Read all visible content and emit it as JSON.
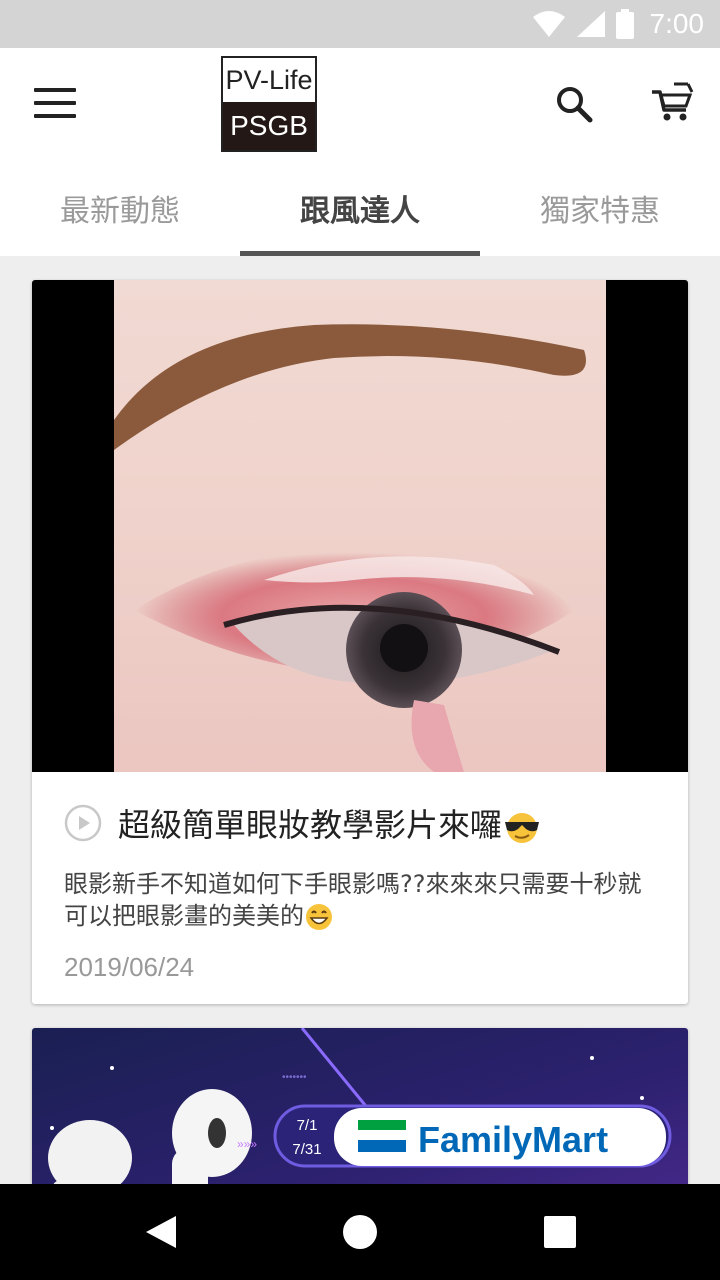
{
  "status_bar": {
    "time": "7:00",
    "icons": [
      "wifi-icon",
      "cellular-icon",
      "battery-icon"
    ]
  },
  "app_bar": {
    "logo_top": "PV-Life",
    "logo_bottom": "PSGB",
    "icons": [
      "menu-icon",
      "search-icon",
      "cart-icon"
    ]
  },
  "tabs": [
    {
      "label": "最新動態",
      "active": false
    },
    {
      "label": "跟風達人",
      "active": true
    },
    {
      "label": "獨家特惠",
      "active": false
    }
  ],
  "feed": {
    "card1": {
      "title": "超級簡單眼妝教學影片來囉",
      "title_emoji": "sunglasses-emoji",
      "description": "眼影新手不知道如何下手眼影嗎??來來來只需要十秒就可以把眼影畫的美美的",
      "description_emoji": "grinning-emoji",
      "date": "2019/06/24"
    },
    "card2": {
      "banner_date_start": "7/1",
      "banner_date_end": "7/31",
      "banner_brand": "FamilyMart"
    }
  },
  "colors": {
    "brand_dark": "#231815",
    "familymart_green": "#00a040",
    "familymart_blue": "#0068b7",
    "banner_purple": "#3a1f7a"
  }
}
